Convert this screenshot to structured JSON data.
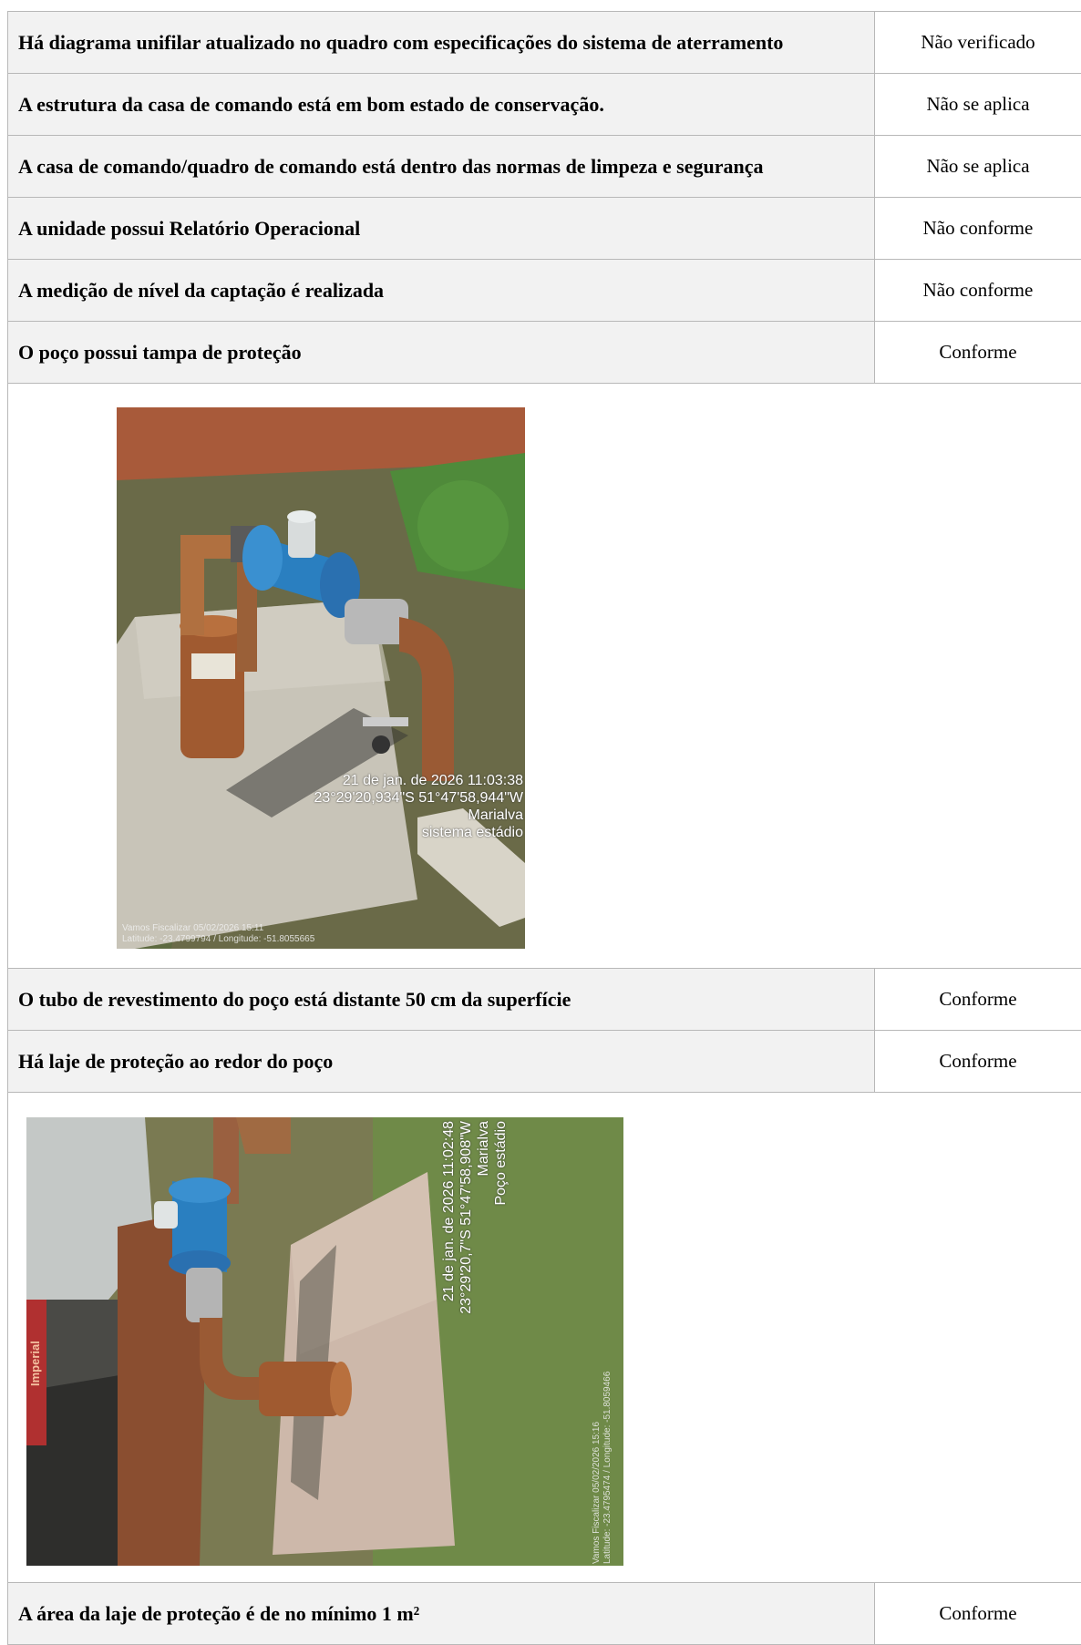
{
  "rows_top": [
    {
      "question": "Há diagrama unifilar atualizado no quadro com especificações do sistema de aterramento",
      "answer": "Não verificado"
    },
    {
      "question": "A estrutura da casa de comando está em bom estado de conservação.",
      "answer": "Não se aplica"
    },
    {
      "question": "A casa de comando/quadro de comando está dentro das normas de limpeza e segurança",
      "answer": "Não se aplica"
    },
    {
      "question": "A unidade possui Relatório Operacional",
      "answer": "Não conforme"
    },
    {
      "question": "A medição de nível da captação é realizada",
      "answer": "Não conforme"
    },
    {
      "question": "O poço possui tampa de proteção",
      "answer": "Conforme"
    }
  ],
  "photo1": {
    "stamp_lines": [
      "21 de jan. de 2026 11:03:38",
      "23°29'20,934\"S 51°47'58,944\"W",
      "Marialva",
      "sistema estádio"
    ],
    "footer_lines": [
      "Vamos Fiscalizar 05/02/2026 15:11",
      "Latitude: -23.4799794 / Longitude: -51.8055665"
    ]
  },
  "rows_middle": [
    {
      "question": "O tubo de revestimento do poço está distante 50 cm da superfície",
      "answer": "Conforme"
    },
    {
      "question": "Há laje de proteção ao redor do poço",
      "answer": "Conforme"
    }
  ],
  "photo2": {
    "stamp_lines": [
      "21 de jan. de 2026 11:02:48",
      "23°29'20,7\"S 51°47'58,908\"W",
      "Marialva",
      "Poço estádio"
    ],
    "footer_lines": [
      "Vamos Fiscalizar 05/02/2026 15:16",
      "Latitude: -23.4795474 / Longitude: -51.8059466"
    ],
    "sign_text": "Imperial"
  },
  "rows_bottom": [
    {
      "question": "A área da laje de proteção é de no mínimo 1 m²",
      "answer": "Conforme"
    }
  ],
  "colors": {
    "question_bg": "#f2f2f2",
    "border": "#b8b8b8",
    "meter_blue": "#2a7fc0",
    "pipe_rust": "#a0582e"
  }
}
